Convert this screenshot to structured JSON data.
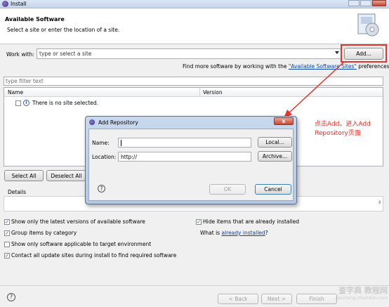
{
  "window": {
    "title": "Install",
    "heading": "Available Software",
    "subheading": "Select a site or enter the location of a site."
  },
  "work_with": {
    "label": "Work with:",
    "placeholder": "type or select a site",
    "add_label": "Add..."
  },
  "find_more": {
    "prefix": "Find more software by working with the ",
    "link": "\"Available Software Sites\"",
    "suffix": " preferences."
  },
  "filter": {
    "placeholder": "type filter text"
  },
  "table": {
    "columns": [
      "Name",
      "Version"
    ],
    "empty_text": "There is no site selected."
  },
  "buttons": {
    "select_all": "Select All",
    "deselect_all": "Deselect All"
  },
  "details_label": "Details",
  "options": {
    "show_latest": "Show only the latest versions of available software",
    "hide_installed": "Hide items that are already installed",
    "group_by_category": "Group items by category",
    "what_is": "What is ",
    "already_installed": "already installed",
    "question_mark": "?",
    "show_applicable": "Show only software applicable to target environment",
    "contact_sites": "Contact all update sites during install to find required software"
  },
  "footer": {
    "back": "< Back",
    "next": "Next >",
    "finish": "Finish"
  },
  "dialog": {
    "title": "Add Repository",
    "name_label": "Name:",
    "name_value": "",
    "location_label": "Location:",
    "location_value": "http://",
    "local_button": "Local...",
    "archive_button": "Archive...",
    "ok_button": "OK",
    "cancel_button": "Cancel",
    "close_glyph": "x"
  },
  "annotation": {
    "line1": "点击Add，进入Add",
    "line2": "Repository页面",
    "color": "#e8322c"
  },
  "icons": [
    "eclipse-icon",
    "cd-install-icon",
    "dropdown-arrow-icon",
    "info-icon",
    "help-icon",
    "checkbox-checked",
    "close-icon"
  ],
  "watermark": {
    "line1": "查字典 教程网",
    "line2": "jiaocheng.chazidian.com"
  }
}
